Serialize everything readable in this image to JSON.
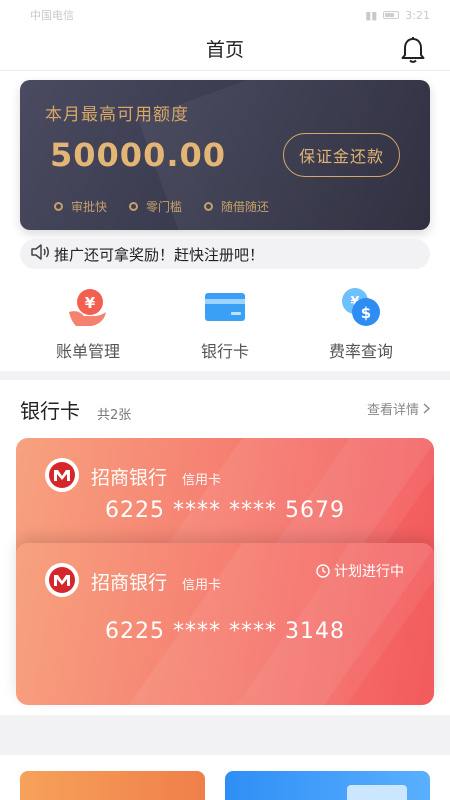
{
  "status_bar": {
    "carrier": "中国电信",
    "time": "3:21"
  },
  "nav": {
    "title": "首页"
  },
  "credit": {
    "title": "本月最高可用额度",
    "amount": "50000.00",
    "button": "保证金还款",
    "tags": [
      "审批快",
      "零门槛",
      "随借随还"
    ]
  },
  "notice": {
    "text": "推广还可拿奖励！赶快注册吧！"
  },
  "menu": [
    {
      "label": "账单管理",
      "icon": "bill-icon"
    },
    {
      "label": "银行卡",
      "icon": "bank-card-icon"
    },
    {
      "label": "费率查询",
      "icon": "rate-icon"
    }
  ],
  "bank_section": {
    "title": "银行卡",
    "count": "共2张",
    "more": "查看详情"
  },
  "cards": [
    {
      "bank": "招商银行",
      "type": "信用卡",
      "number": "6225 **** **** 5679"
    },
    {
      "bank": "招商银行",
      "type": "信用卡",
      "number": "6225 **** **** 3148",
      "status": "计划进行中"
    }
  ],
  "colors": {
    "gold": "#d6a867",
    "card_red": "#f35a5d",
    "card_orange": "#f7a27e"
  }
}
